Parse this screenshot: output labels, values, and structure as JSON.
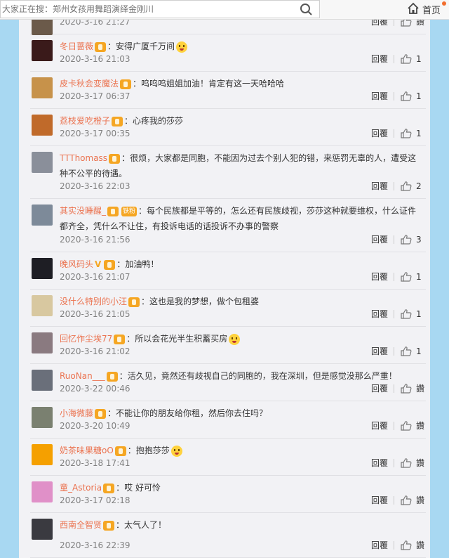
{
  "topbar": {
    "search_placeholder": "大家正在搜：郑州女孩用舞蹈演绎金刚川",
    "home_label": "首页"
  },
  "reply_label": "回覆",
  "like_label": "讚",
  "comments": [
    {
      "user": "",
      "text": "",
      "time": "2020-3-16 21:27",
      "likes": "讚",
      "avatar_color": "#6b5a4a"
    },
    {
      "user": "冬日蔷薇",
      "text": "：安得广厦千万间",
      "time": "2020-3-16 21:03",
      "likes": "1",
      "avatar_color": "#3a1a1a"
    },
    {
      "user": "皮卡秋会变魔法",
      "text": "：呜呜呜姐姐加油！肯定有这一天哈哈哈",
      "time": "2020-3-17 06:37",
      "likes": "1",
      "avatar_color": "#c7924a"
    },
    {
      "user": "荔枝爱吃橙子",
      "text": "：心疼我的莎莎",
      "time": "2020-3-17 00:35",
      "likes": "1",
      "avatar_color": "#c06a2a"
    },
    {
      "user": "TTThomass",
      "text": "：很烦，大家都是同胞，不能因为过去个别人犯的错，来惩罚无辜的人，遭受这种不公平的待遇。",
      "time": "2020-3-16 22:03",
      "likes": "2",
      "avatar_color": "#8a8f9a"
    },
    {
      "user": "其实没睡醒_",
      "text": "：每个民族都是平等的，怎么还有民族歧视，莎莎这种就要维权，什么证件都齐全，凭什么不让住，有投诉电话的话投诉不办事的警察",
      "badge2": "铁粉",
      "time": "2020-3-16 21:56",
      "likes": "3",
      "avatar_color": "#7d8a99"
    },
    {
      "user": "晚风码头",
      "text": "：加油鸭！",
      "vmark": "V",
      "time": "2020-3-16 21:07",
      "likes": "1",
      "avatar_color": "#1e1e24"
    },
    {
      "user": "没什么特别的小汪",
      "text": "：这也是我的梦想，做个包租婆",
      "time": "2020-3-16 21:05",
      "likes": "1",
      "avatar_color": "#d8c8a0"
    },
    {
      "user": "回忆作尘埃77",
      "text": "：所以会花光半生积蓄买房",
      "time": "2020-3-16 21:02",
      "likes": "1",
      "avatar_color": "#8a7a80"
    },
    {
      "user": "RuoNan___",
      "text": "：活久见，竟然还有歧视自己的同胞的，我在深圳，但是感觉没那么严重！",
      "time": "2020-3-22 00:46",
      "likes": "讚",
      "avatar_color": "#6a6f7a"
    },
    {
      "user": "小海微藤",
      "text": "：不能让你的朋友给你租，然后你去住吗？",
      "time": "2020-3-20 10:49",
      "likes": "讚",
      "avatar_color": "#7a8070"
    },
    {
      "user": "奶茶味果糖oO",
      "text": "：抱抱莎莎",
      "time": "2020-3-18 17:41",
      "likes": "讚",
      "avatar_color": "#f5a000"
    },
    {
      "user": "童_Astoria",
      "text": "：哎 好可怜",
      "time": "2020-3-17 02:18",
      "likes": "讚",
      "avatar_color": "#e090c8"
    },
    {
      "user": "西南全智贤",
      "text": "：太气人了！",
      "time": "2020-3-16 22:39",
      "likes": "讚",
      "avatar_color": "#3a3a40"
    }
  ]
}
